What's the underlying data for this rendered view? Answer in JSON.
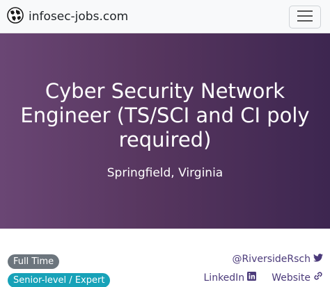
{
  "navbar": {
    "brand_name": "infosec-jobs.com",
    "logo_icon": "world-icon",
    "toggle_icon": "hamburger-icon"
  },
  "hero": {
    "title": "Cyber Security Network Engineer (TS/SCI and CI poly required)",
    "location": "Springfield, Virginia",
    "gradient_colors": [
      "#6a4674",
      "#3d2650"
    ]
  },
  "tags": {
    "employment_type": "Full Time",
    "level": "Senior-level / Expert"
  },
  "company_links": {
    "twitter_handle": "@RiversideRsch",
    "linkedin_label": "LinkedIn",
    "website_label": "Website"
  },
  "colors": {
    "accent": "#4b3a7a",
    "badge_gray": "#6c757d",
    "badge_teal": "#17a2b8"
  }
}
